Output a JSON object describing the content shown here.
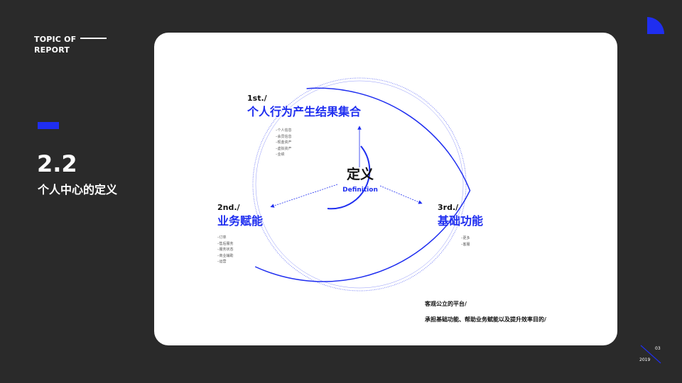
{
  "header": {
    "topic_line1": "TOPIC OF",
    "topic_line2": "REPORT"
  },
  "section": {
    "number": "2.2",
    "title": "个人中心的定义"
  },
  "center": {
    "title": "定义",
    "subtitle": "Definition"
  },
  "nodes": [
    {
      "num": "1st./",
      "title": "个人行为产生结果集合",
      "items": [
        "个人信息",
        "会员信息",
        "现金资产",
        "虚拟资产",
        "业绩"
      ]
    },
    {
      "num": "2nd./",
      "title": "业务赋能",
      "items": [
        "订单",
        "售后服务",
        "服务状态",
        "商业辅助",
        "运营"
      ]
    },
    {
      "num": "3rd./",
      "title": "基础功能",
      "items": [
        "更多",
        "客服"
      ]
    }
  ],
  "statement": {
    "line1": "客观公立的平台/",
    "line2": "承担基础功能、帮助业务赋能以及提升效率目的/"
  },
  "footer": {
    "page": "03",
    "year": "2019"
  },
  "colors": {
    "accent": "#1f2ef0",
    "background": "#2a2a2a",
    "card": "#ffffff"
  }
}
